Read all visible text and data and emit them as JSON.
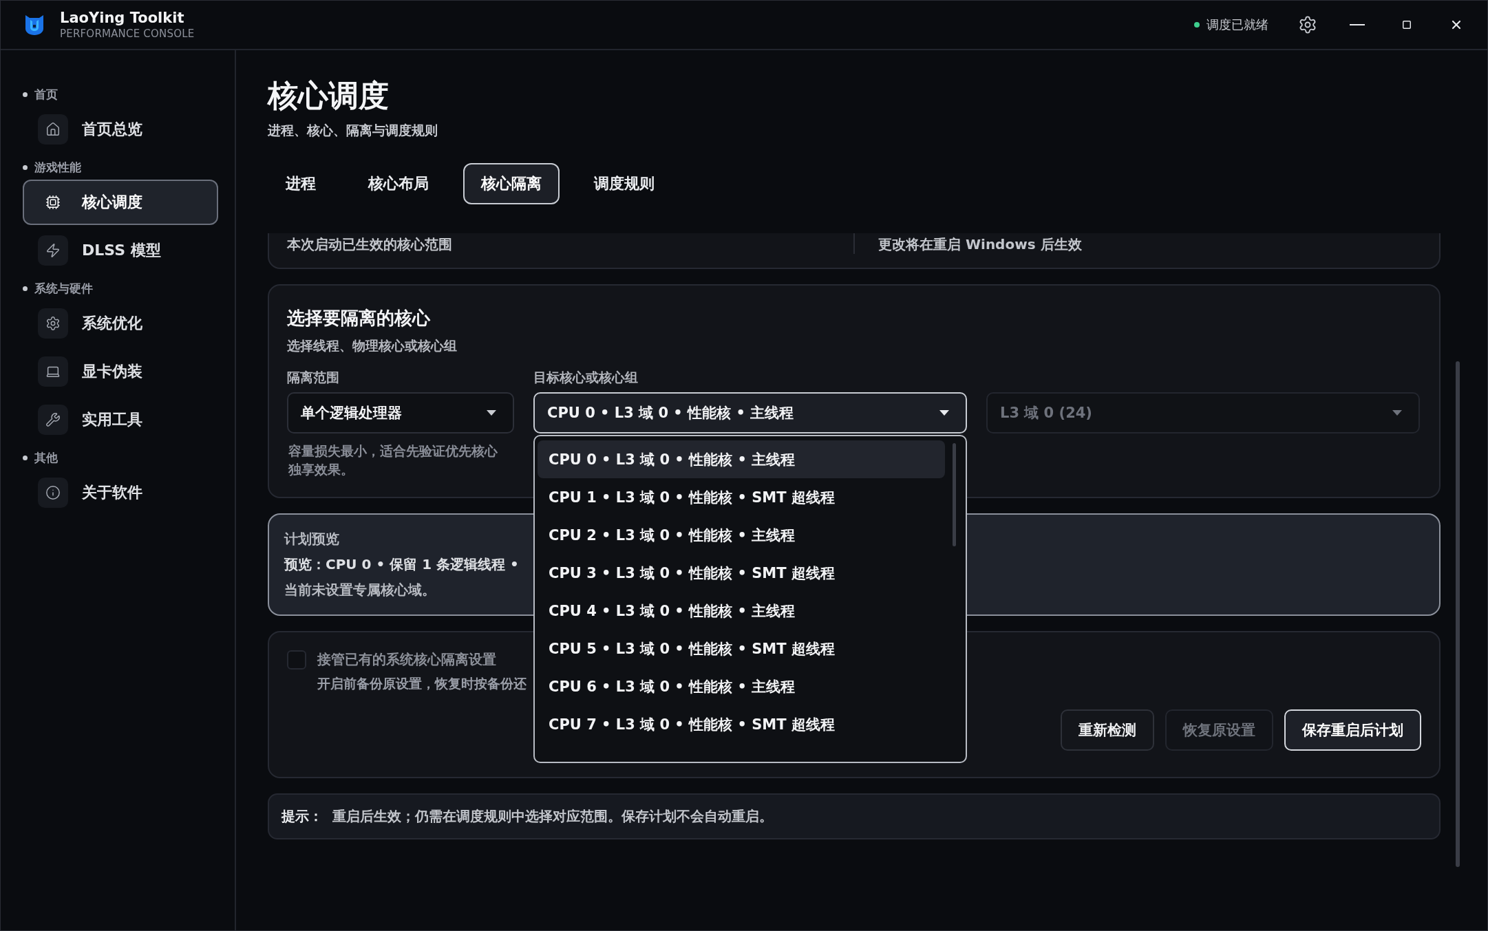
{
  "app": {
    "name": "LaoYing Toolkit",
    "subtitle": "PERFORMANCE CONSOLE"
  },
  "status": {
    "text": "调度已就绪",
    "color": "#3ecf8e"
  },
  "sidebar": {
    "sections": [
      {
        "label": "首页",
        "items": [
          {
            "label": "首页总览",
            "selected": false
          }
        ]
      },
      {
        "label": "游戏性能",
        "items": [
          {
            "label": "核心调度",
            "selected": true
          },
          {
            "label": "DLSS 模型",
            "selected": false
          }
        ]
      },
      {
        "label": "系统与硬件",
        "items": [
          {
            "label": "系统优化",
            "selected": false
          },
          {
            "label": "显卡伪装",
            "selected": false
          },
          {
            "label": "实用工具",
            "selected": false
          }
        ]
      },
      {
        "label": "其他",
        "items": [
          {
            "label": "关于软件",
            "selected": false
          }
        ]
      }
    ]
  },
  "page": {
    "title": "核心调度",
    "subtitle": "进程、核心、隔离与调度规则"
  },
  "tabs": [
    {
      "label": "进程",
      "selected": false
    },
    {
      "label": "核心布局",
      "selected": false
    },
    {
      "label": "核心隔离",
      "selected": true
    },
    {
      "label": "调度规则",
      "selected": false
    }
  ],
  "applied_card": {
    "current": "本次启动已生效的核心范围",
    "pending": "更改将在重启 Windows 后生效"
  },
  "select_card": {
    "title": "选择要隔离的核心",
    "subtitle": "选择线程、物理核心或核心组",
    "scope": {
      "label": "隔离范围",
      "value": "单个逻辑处理器",
      "hint": "容量损失最小，适合先验证优先核心独享效果。"
    },
    "target": {
      "label": "目标核心或核心组",
      "value": "CPU 0 • L3 域 0 • 性能核 • 主线程",
      "expanded": true,
      "options": [
        {
          "label": "CPU 0 • L3 域 0 • 性能核 • 主线程",
          "selected": true
        },
        {
          "label": "CPU 1 • L3 域 0 • 性能核 • SMT 超线程",
          "selected": false
        },
        {
          "label": "CPU 2 • L3 域 0 • 性能核 • 主线程",
          "selected": false
        },
        {
          "label": "CPU 3 • L3 域 0 • 性能核 • SMT 超线程",
          "selected": false
        },
        {
          "label": "CPU 4 • L3 域 0 • 性能核 • 主线程",
          "selected": false
        },
        {
          "label": "CPU 5 • L3 域 0 • 性能核 • SMT 超线程",
          "selected": false
        },
        {
          "label": "CPU 6 • L3 域 0 • 性能核 • 主线程",
          "selected": false
        },
        {
          "label": "CPU 7 • L3 域 0 • 性能核 • SMT 超线程",
          "selected": false
        }
      ]
    },
    "domain": {
      "value": "L3 域 0 (24)",
      "disabled": true
    }
  },
  "preview": {
    "title": "计划预览",
    "summary": "预览：CPU 0 • 保留 1 条逻辑线程 •",
    "note": "当前未设置专属核心域。"
  },
  "takeover": {
    "label": "接管已有的系统核心隔离设置",
    "checked": false,
    "disabled": true,
    "description": "开启前备份原设置，恢复时按备份还"
  },
  "buttons": [
    {
      "label": "重新检测",
      "kind": "default",
      "disabled": false
    },
    {
      "label": "恢复原设置",
      "kind": "default",
      "disabled": true
    },
    {
      "label": "保存重启后计划",
      "kind": "primary",
      "disabled": false
    }
  ],
  "tip": {
    "label": "提示：",
    "text": "重启后生效；仍需在调度规则中选择对应范围。保存计划不会自动重启。"
  }
}
